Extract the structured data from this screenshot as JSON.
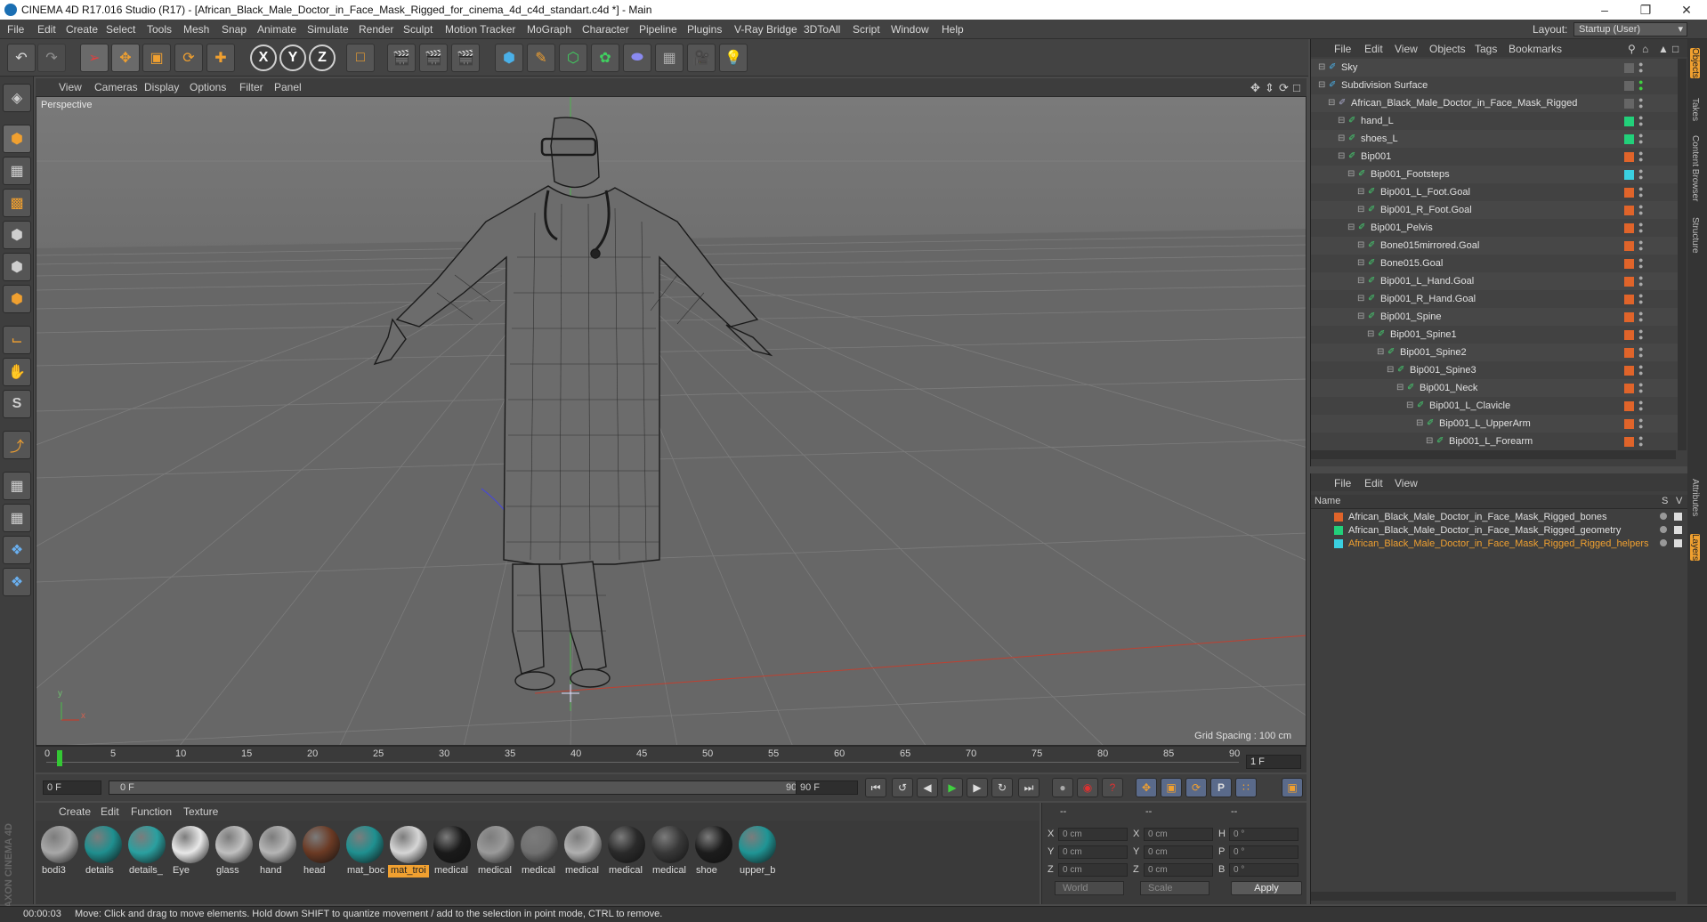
{
  "window": {
    "title": "CINEMA 4D R17.016 Studio (R17) - [African_Black_Male_Doctor_in_Face_Mask_Rigged_for_cinema_4d_c4d_standart.c4d *] - Main",
    "minimize": "–",
    "maximize": "❐",
    "close": "✕"
  },
  "menubar": {
    "items": [
      "File",
      "Edit",
      "Create",
      "Select",
      "Tools",
      "Mesh",
      "Snap",
      "Animate",
      "Simulate",
      "Render",
      "Sculpt",
      "Motion Tracker",
      "MoGraph",
      "Character",
      "Pipeline",
      "Plugins",
      "V-Ray Bridge",
      "3DToAll",
      "Script",
      "Window",
      "Help"
    ],
    "layout_label": "Layout:",
    "layout_value": "Startup (User)"
  },
  "toolbar": {
    "undo_icon": "undo-icon",
    "redo_icon": "redo-icon",
    "x_label": "X",
    "y_label": "Y",
    "z_label": "Z"
  },
  "viewport": {
    "menu": [
      "View",
      "Cameras",
      "Display",
      "Options",
      "Filter",
      "Panel"
    ],
    "camera_label": "Perspective",
    "grid_spacing": "Grid Spacing : 100 cm",
    "axis_x": "x",
    "axis_y": "y"
  },
  "timeline": {
    "ticks": [
      "0",
      "5",
      "10",
      "15",
      "20",
      "25",
      "30",
      "35",
      "40",
      "45",
      "50",
      "55",
      "60",
      "65",
      "70",
      "75",
      "80",
      "85",
      "90"
    ],
    "current_frame": "1 F"
  },
  "playback": {
    "start_field": "0 F",
    "slider_start": "0 F",
    "slider_end": "90 F",
    "end_field": "90 F"
  },
  "material_manager": {
    "menu": [
      "Create",
      "Edit",
      "Function",
      "Texture"
    ],
    "materials": [
      {
        "label": "bodi3",
        "color": "#a8a8a8"
      },
      {
        "label": "details",
        "color": "#1f8f8f"
      },
      {
        "label": "details_",
        "color": "#2aa0a0"
      },
      {
        "label": "Eye",
        "color": "#e8e8e8"
      },
      {
        "label": "glass",
        "color": "#c0c0c0"
      },
      {
        "label": "hand",
        "color": "#b5b5b5"
      },
      {
        "label": "head",
        "color": "#6b3a24"
      },
      {
        "label": "mat_boc",
        "color": "#1f9090"
      },
      {
        "label": "mat_troi",
        "color": "#d6d6d6"
      },
      {
        "label": "medical",
        "color": "#1a1a1a"
      },
      {
        "label": "medical",
        "color": "#9a9a9a"
      },
      {
        "label": "medical",
        "color": "#707070"
      },
      {
        "label": "medical",
        "color": "#b0b0b0"
      },
      {
        "label": "medical",
        "color": "#2a2a2a"
      },
      {
        "label": "medical",
        "color": "#383838"
      },
      {
        "label": "shoe",
        "color": "#1c1c1c"
      },
      {
        "label": "upper_b",
        "color": "#1f9595"
      }
    ]
  },
  "coordinates": {
    "header": [
      "--",
      "--",
      "--"
    ],
    "rows": [
      {
        "a": "X",
        "av": "0 cm",
        "b": "X",
        "bv": "0 cm",
        "c": "H",
        "cv": "0 °"
      },
      {
        "a": "Y",
        "av": "0 cm",
        "b": "Y",
        "bv": "0 cm",
        "c": "P",
        "cv": "0 °"
      },
      {
        "a": "Z",
        "av": "0 cm",
        "b": "Z",
        "bv": "0 cm",
        "c": "B",
        "cv": "0 °"
      }
    ],
    "world": "World",
    "scale": "Scale",
    "apply": "Apply"
  },
  "object_manager": {
    "menu": [
      "File",
      "Edit",
      "View",
      "Objects",
      "Tags",
      "Bookmarks"
    ],
    "objects": [
      {
        "name": "Sky",
        "indent": 0,
        "layer": ""
      },
      {
        "name": "Subdivision Surface",
        "indent": 0,
        "layer": ""
      },
      {
        "name": "African_Black_Male_Doctor_in_Face_Mask_Rigged",
        "indent": 1,
        "layer": ""
      },
      {
        "name": "hand_L",
        "indent": 2,
        "layer": "#22d07a"
      },
      {
        "name": "shoes_L",
        "indent": 2,
        "layer": "#22d07a"
      },
      {
        "name": "Bip001",
        "indent": 2,
        "layer": "#e0642a"
      },
      {
        "name": "Bip001_Footsteps",
        "indent": 3,
        "layer": "#3ad0e0"
      },
      {
        "name": "Bip001_L_Foot.Goal",
        "indent": 4,
        "layer": "#e0642a"
      },
      {
        "name": "Bip001_R_Foot.Goal",
        "indent": 4,
        "layer": "#e0642a"
      },
      {
        "name": "Bip001_Pelvis",
        "indent": 3,
        "layer": "#e0642a"
      },
      {
        "name": "Bone015mirrored.Goal",
        "indent": 4,
        "layer": "#e0642a"
      },
      {
        "name": "Bone015.Goal",
        "indent": 4,
        "layer": "#e0642a"
      },
      {
        "name": "Bip001_L_Hand.Goal",
        "indent": 4,
        "layer": "#e0642a"
      },
      {
        "name": "Bip001_R_Hand.Goal",
        "indent": 4,
        "layer": "#e0642a"
      },
      {
        "name": "Bip001_Spine",
        "indent": 4,
        "layer": "#e0642a"
      },
      {
        "name": "Bip001_Spine1",
        "indent": 5,
        "layer": "#e0642a"
      },
      {
        "name": "Bip001_Spine2",
        "indent": 6,
        "layer": "#e0642a"
      },
      {
        "name": "Bip001_Spine3",
        "indent": 7,
        "layer": "#e0642a"
      },
      {
        "name": "Bip001_Neck",
        "indent": 8,
        "layer": "#e0642a"
      },
      {
        "name": "Bip001_L_Clavicle",
        "indent": 9,
        "layer": "#e0642a"
      },
      {
        "name": "Bip001_L_UpperArm",
        "indent": 10,
        "layer": "#e0642a"
      },
      {
        "name": "Bip001_L_Forearm",
        "indent": 11,
        "layer": "#e0642a"
      }
    ]
  },
  "layer_manager": {
    "menu": [
      "File",
      "Edit",
      "View"
    ],
    "col_name": "Name",
    "col_s": "S",
    "col_v": "V",
    "layers": [
      {
        "name": "African_Black_Male_Doctor_in_Face_Mask_Rigged_bones",
        "color": "#e0642a",
        "text_color": "#e0e0e0"
      },
      {
        "name": "African_Black_Male_Doctor_in_Face_Mask_Rigged_geometry",
        "color": "#22d07a",
        "text_color": "#e0e0e0"
      },
      {
        "name": "African_Black_Male_Doctor_in_Face_Mask_Rigged_Rigged_helpers",
        "color": "#3ad0e0",
        "text_color": "#f0a030"
      }
    ]
  },
  "right_tabs": [
    "Objects",
    "Takes",
    "Content Browser",
    "Structure",
    "Attributes",
    "Layers"
  ],
  "status": {
    "time": "00:00:03",
    "message": "Move: Click and drag to move elements. Hold down SHIFT to quantize movement / add to the selection in point mode, CTRL to remove."
  },
  "brand": "MAXON CINEMA 4D"
}
